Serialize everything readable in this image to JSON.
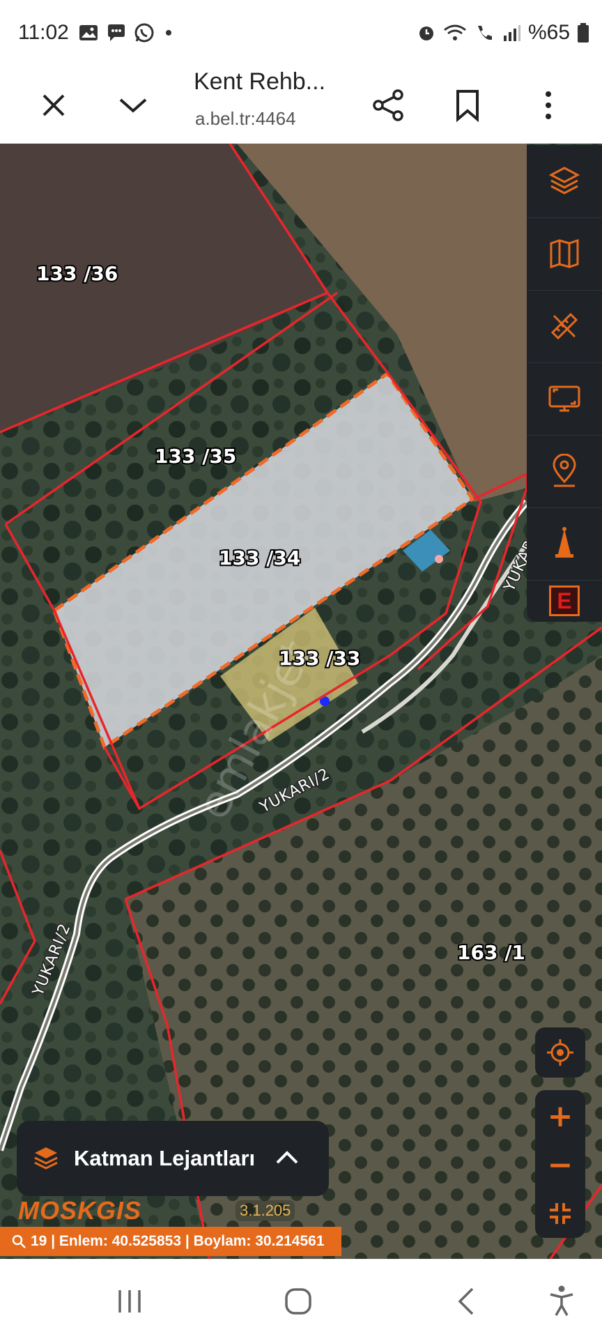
{
  "status_bar": {
    "time": "11:02",
    "battery": "%65",
    "left_icons": [
      "gallery-icon",
      "chat-icon",
      "whatsapp-icon",
      "dot-icon"
    ],
    "right_icons": [
      "alarm-icon",
      "wifi-icon",
      "call-icon",
      "signal-icon",
      "battery-icon"
    ]
  },
  "browser": {
    "title": "Kent Rehb...",
    "url": "a.bel.tr:4464",
    "buttons": [
      "close-icon",
      "chevron-down-icon",
      "share-icon",
      "bookmark-icon",
      "more-icon"
    ]
  },
  "map": {
    "parcels": [
      "133 /36",
      "133 /35",
      "133 /34",
      "133 /33",
      "163 /1"
    ],
    "roads": [
      "YUKARI/2",
      "YUKARI/2",
      "YUKARI"
    ],
    "watermark": "emlakjet"
  },
  "toolbar": {
    "tools": [
      "layers-icon",
      "map-icon",
      "measure-icon",
      "screen-icon",
      "location-pin-icon",
      "bell-icon",
      "e-icon"
    ],
    "e_label": "E"
  },
  "controls": {
    "locate_icon": "crosshair-icon",
    "zoom_in": "+",
    "zoom_out": "−",
    "fullscreen_icon": "collapse-icon"
  },
  "legend": {
    "label": "Katman Lejantları"
  },
  "branding": {
    "logo": "MOSKGIS",
    "version": "3.1.205"
  },
  "coords": {
    "text": "19 | Enlem: 40.525853 | Boylam: 30.214561"
  },
  "colors": {
    "accent": "#e56a1c",
    "panel": "#1f2328",
    "parcel_border": "#e8262c",
    "selected_border": "#f06a2a"
  }
}
